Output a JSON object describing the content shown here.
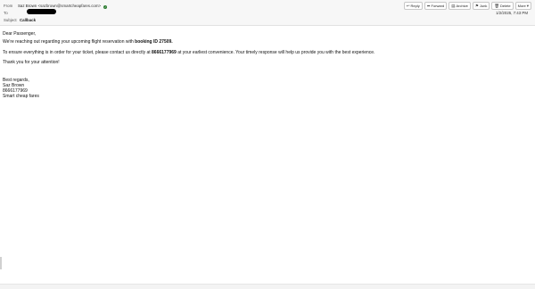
{
  "header": {
    "from_label": "From",
    "sender_name": "Saz Brown",
    "sender_email": "<sazbrown@smartcheapfares.com>",
    "to_label": "To",
    "subject_label": "Subject",
    "subject": "Callback",
    "date": "1/2/2025, 7:43 PM"
  },
  "toolbar": {
    "reply": "Reply",
    "forward": "Forward",
    "archive": "Archive",
    "junk": "Junk",
    "delete": "Delete",
    "more": "More"
  },
  "body": {
    "greeting": "Dear Passenger,",
    "para1_before": "We're reaching out regarding your upcoming flight reservation with ",
    "para1_bold": "booking ID 27509.",
    "para2_before": "To ensure everything is in order for your ticket, please contact us directly at ",
    "para2_bold": "8666177969",
    "para2_after": " at your earliest convenience. Your timely response will help us provide you with the best experience.",
    "para3": "Thank you for your attention!",
    "sig_line1": "Best regards,",
    "sig_line2": "Saz Brown",
    "sig_line3": "8666177969",
    "sig_line4": "Smart cheap fares"
  },
  "colors": {
    "header_bg": "#f7f7f7",
    "online_status": "#2e7d32"
  },
  "icons": [
    "reply-icon",
    "forward-icon",
    "archive-icon",
    "junk-icon",
    "delete-icon",
    "chevron-down-icon",
    "online-status-icon"
  ]
}
